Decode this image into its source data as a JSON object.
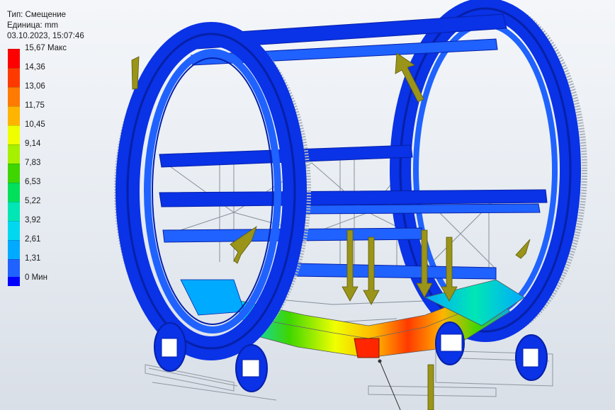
{
  "result_info": {
    "type_line": "Тип: Смещение",
    "unit_line": "Единица: mm",
    "timestamp": "03.10.2023, 15:07:46"
  },
  "legend": {
    "levels": [
      {
        "label": "15,67 Макс",
        "color": "#ff0000"
      },
      {
        "label": "14,36",
        "color": "#ff3a00"
      },
      {
        "label": "13,06",
        "color": "#ff7a00"
      },
      {
        "label": "11,75",
        "color": "#ffb400"
      },
      {
        "label": "10,45",
        "color": "#f0ff00"
      },
      {
        "label": "9,14",
        "color": "#a6f000"
      },
      {
        "label": "7,83",
        "color": "#3fd600"
      },
      {
        "label": "6,53",
        "color": "#00e05a"
      },
      {
        "label": "5,22",
        "color": "#00e6b4"
      },
      {
        "label": "3,92",
        "color": "#00d8f0"
      },
      {
        "label": "2,61",
        "color": "#00aaff"
      },
      {
        "label": "1,31",
        "color": "#1f62ff"
      },
      {
        "label": "0 Мин",
        "color": "#0000ff"
      }
    ]
  },
  "colors": {
    "frame": "#0a32e6",
    "frame_dark": "#0620a8",
    "wireframe": "#7d8792",
    "load_arrow": "#9a9418"
  }
}
